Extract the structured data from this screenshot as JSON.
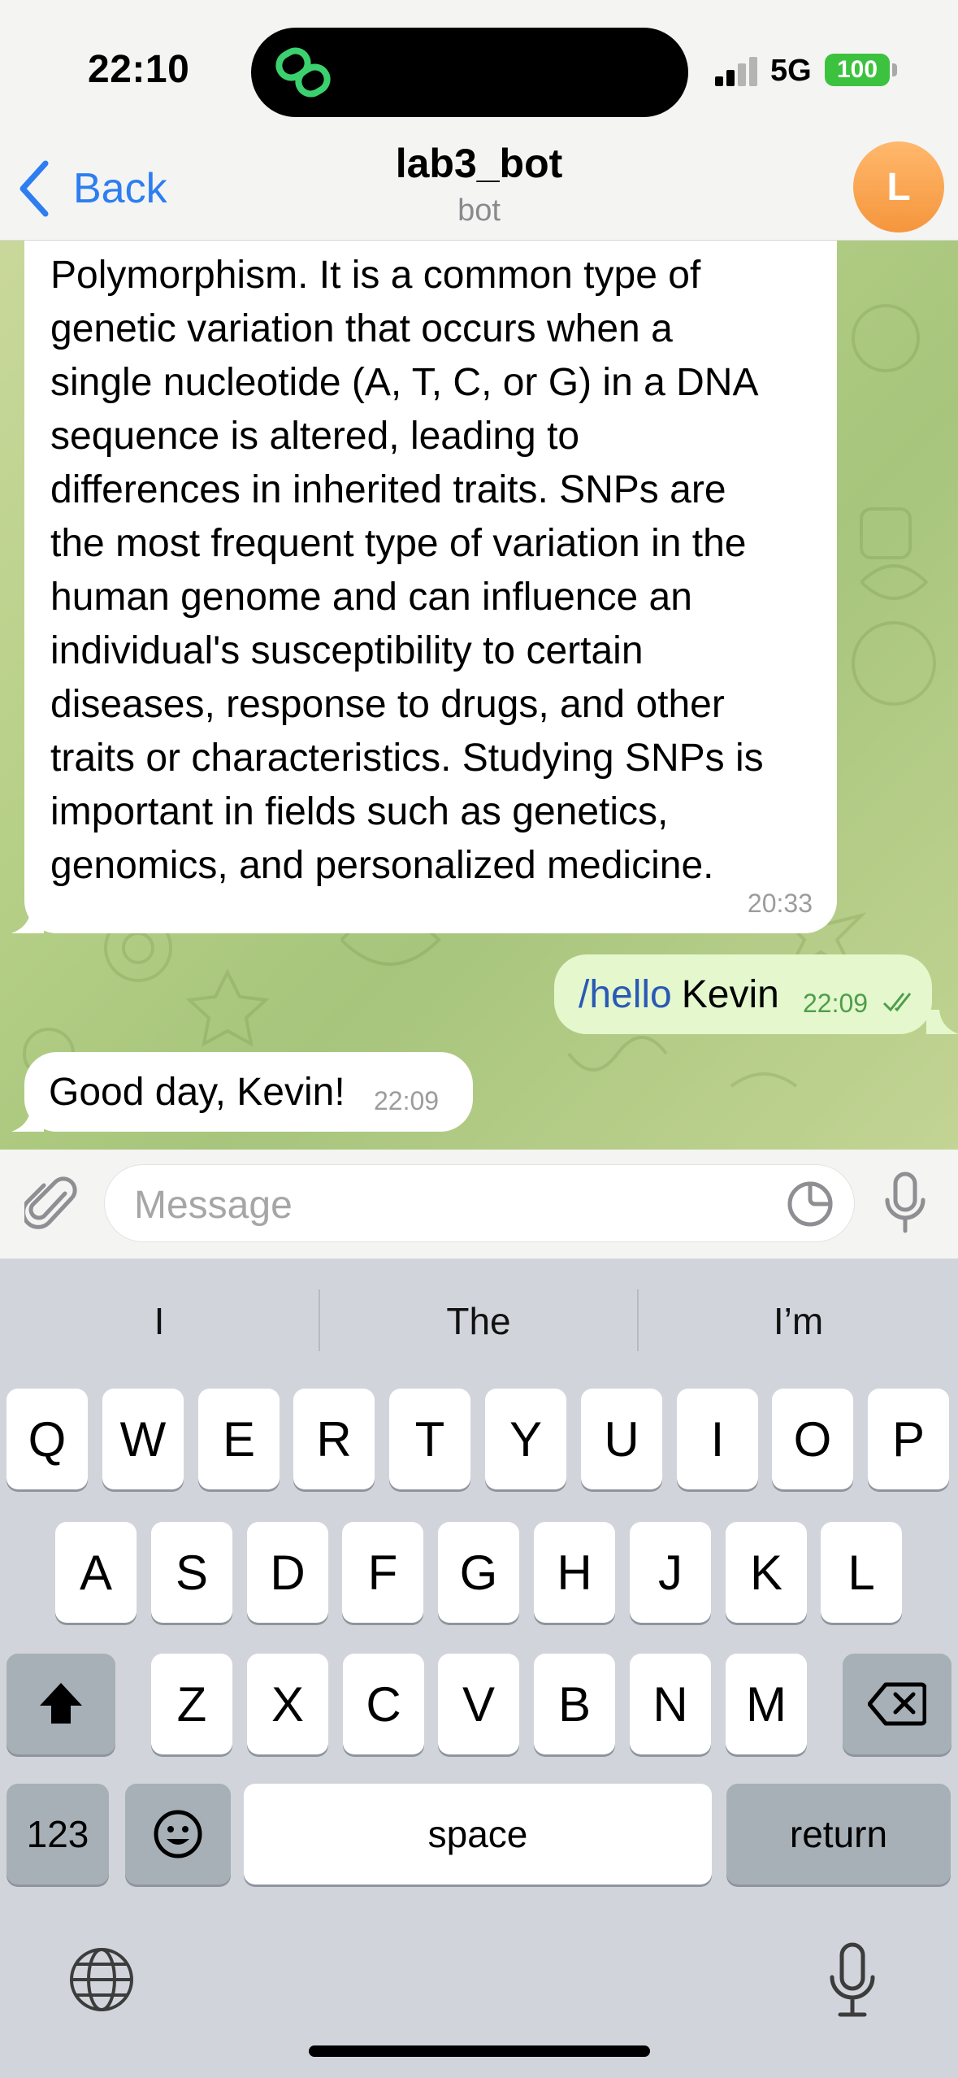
{
  "status_bar": {
    "time": "22:10",
    "network": "5G",
    "battery": "100"
  },
  "header": {
    "back_label": "Back",
    "title": "lab3_bot",
    "subtitle": "bot",
    "avatar_initial": "L"
  },
  "messages": [
    {
      "direction": "incoming",
      "text": "Polymorphism. It is a common type of\ngenetic variation that occurs when a\nsingle nucleotide (A, T, C, or G) in a DNA\nsequence is altered, leading to\ndifferences in inherited traits. SNPs are\nthe most frequent type of variation in the\nhuman genome and can influence an\nindividual's susceptibility to certain\ndiseases, response to drugs, and other\ntraits or characteristics. Studying SNPs is\nimportant in fields such as genetics,\ngenomics, and personalized medicine.",
      "time": "20:33"
    },
    {
      "direction": "outgoing",
      "command": "/hello",
      "text": "Kevin",
      "time": "22:09",
      "status": "read"
    },
    {
      "direction": "incoming",
      "text": "Good day, Kevin!",
      "time": "22:09"
    }
  ],
  "composer": {
    "placeholder": "Message"
  },
  "keyboard": {
    "suggestions": [
      "I",
      "The",
      "I’m"
    ],
    "row1": [
      "Q",
      "W",
      "E",
      "R",
      "T",
      "Y",
      "U",
      "I",
      "O",
      "P"
    ],
    "row2": [
      "A",
      "S",
      "D",
      "F",
      "G",
      "H",
      "J",
      "K",
      "L"
    ],
    "row3": [
      "Z",
      "X",
      "C",
      "V",
      "B",
      "N",
      "M"
    ],
    "numbers_label": "123",
    "space_label": "space",
    "return_label": "return"
  },
  "colors": {
    "accent": "#2d7ef0",
    "outgoing_bubble": "#e4f7cd",
    "battery": "#3cc23f",
    "avatar": "#f5a04a"
  }
}
